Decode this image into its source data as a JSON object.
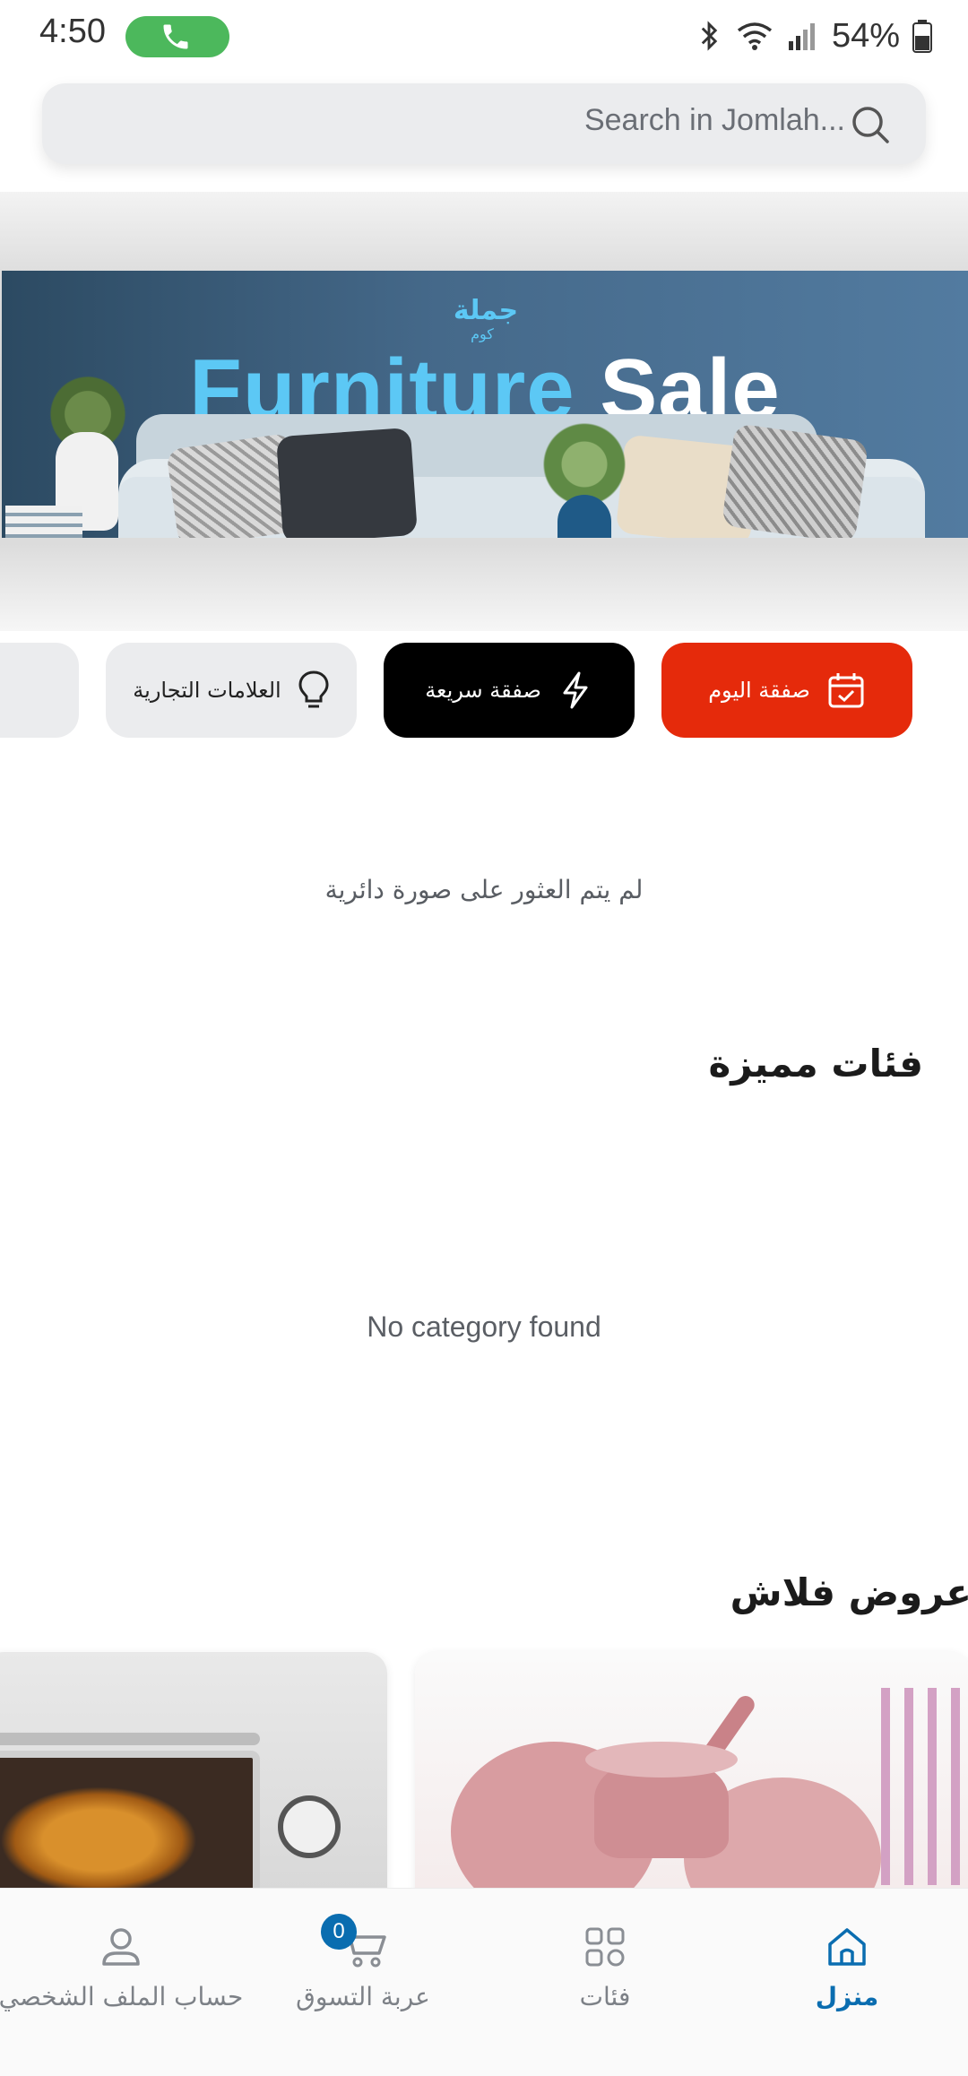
{
  "status_bar": {
    "time": "4:50",
    "battery": "54%",
    "icons": [
      "phone-call-icon",
      "bluetooth-icon",
      "wifi-icon",
      "signal-icon",
      "battery-icon"
    ]
  },
  "search": {
    "placeholder": "Search in Jomlah...",
    "icon": "search-icon"
  },
  "banner": {
    "logo_text": "جملة",
    "logo_sub": "كوم",
    "title_word1": "Furniture",
    "title_word2": "Sale"
  },
  "chips": [
    {
      "label": "صفقة اليوم",
      "icon": "calendar-check-icon",
      "color": "#e52a0b"
    },
    {
      "label": "صفقة سريعة",
      "icon": "lightning-icon",
      "color": "#000000"
    },
    {
      "label": "العلامات التجارية",
      "icon": "lightbulb-icon",
      "color": "#ebecee"
    },
    {
      "label": "",
      "icon": "crown-icon",
      "color": "#ebecee"
    }
  ],
  "slider_empty_text": "لم يتم العثور على صورة دائرية",
  "featured": {
    "title": "فئات مميزة",
    "empty_text": "No category found"
  },
  "flash": {
    "title": "عروض فلاش"
  },
  "bottom_nav": {
    "home": "منزل",
    "categories": "فئات",
    "cart": "عربة التسوق",
    "cart_count": "0",
    "profile": "حساب الملف الشخصي"
  },
  "colors": {
    "accent": "#0a6db0",
    "deal_today": "#e52a0b",
    "fast_deal": "#000000"
  }
}
